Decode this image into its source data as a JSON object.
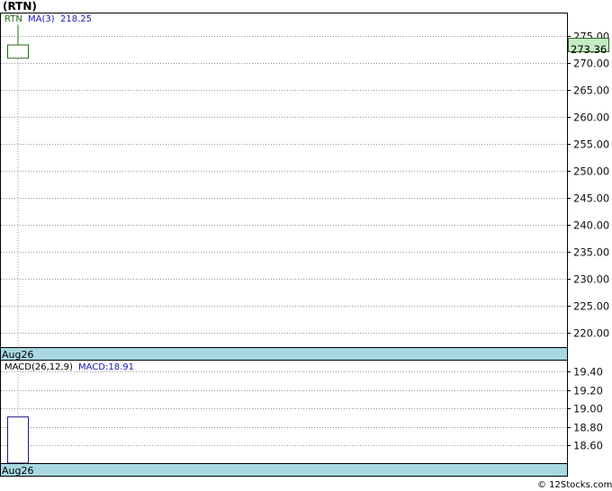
{
  "colors": {
    "background": "#ffffff",
    "panel_border": "#000000",
    "grid": "#9a9a9a",
    "date_bar_fill": "#a8d8e2",
    "candle_stroke": "#2a6a1c",
    "candle_fill": "#ffffff",
    "legend_symbol": "#2a6a1c",
    "legend_ma": "#1a1ab4",
    "last_price_fill": "#c6ecc6"
  },
  "chart_data": [
    {
      "type": "candlestick",
      "title": "(RTN)",
      "symbol": "RTN",
      "ma_label": "MA(3)",
      "ma_value": "218.25",
      "x": [
        "Aug26"
      ],
      "candles": [
        {
          "date": "Aug26",
          "open": 273.36,
          "high": 277.0,
          "low": 270.9,
          "close": 270.9
        }
      ],
      "last_price": 273.36,
      "last_price_label": "273.36",
      "yticks": [
        "275.00",
        "270.00",
        "265.00",
        "260.00",
        "255.00",
        "250.00",
        "245.00",
        "240.00",
        "235.00",
        "230.00",
        "225.00",
        "220.00"
      ],
      "ylim": [
        217.3,
        279.2
      ],
      "grid": true,
      "date_label": "Aug26"
    },
    {
      "type": "bar",
      "label": "MACD(26,12,9)",
      "value_label": "MACD:18.91",
      "x": [
        "Aug26"
      ],
      "values": [
        18.91
      ],
      "yticks": [
        "19.40",
        "19.20",
        "19.00",
        "18.80",
        "18.60"
      ],
      "ylim": [
        18.41,
        19.52
      ],
      "grid": true,
      "date_label": "Aug26"
    }
  ],
  "credit": "© 12Stocks.com"
}
